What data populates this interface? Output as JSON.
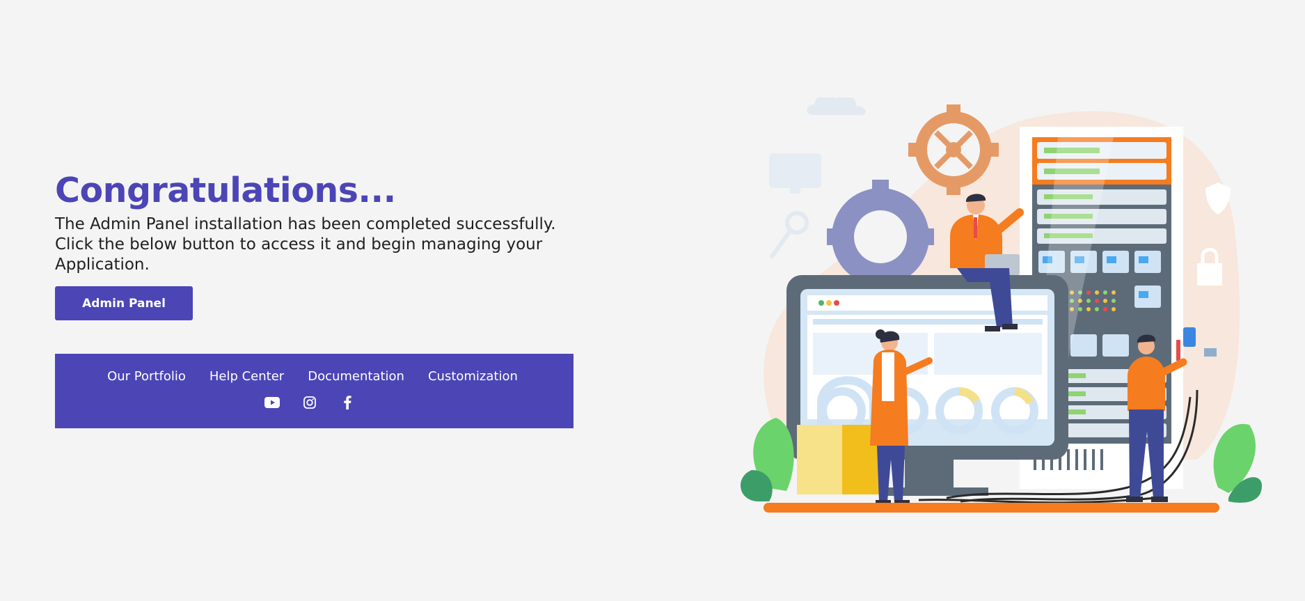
{
  "hero": {
    "title": "Congratulations...",
    "description": "The Admin Panel installation has been completed successfully. Click the below button to access it and begin managing your Application.",
    "button_label": "Admin Panel"
  },
  "footer": {
    "links": [
      "Our Portfolio",
      "Help Center",
      "Documentation",
      "Customization"
    ],
    "social_icons": [
      "youtube-icon",
      "instagram-icon",
      "facebook-icon"
    ]
  },
  "colors": {
    "accent": "#4c45b6",
    "background": "#f4f4f4",
    "illustration_orange": "#f57c1f"
  }
}
